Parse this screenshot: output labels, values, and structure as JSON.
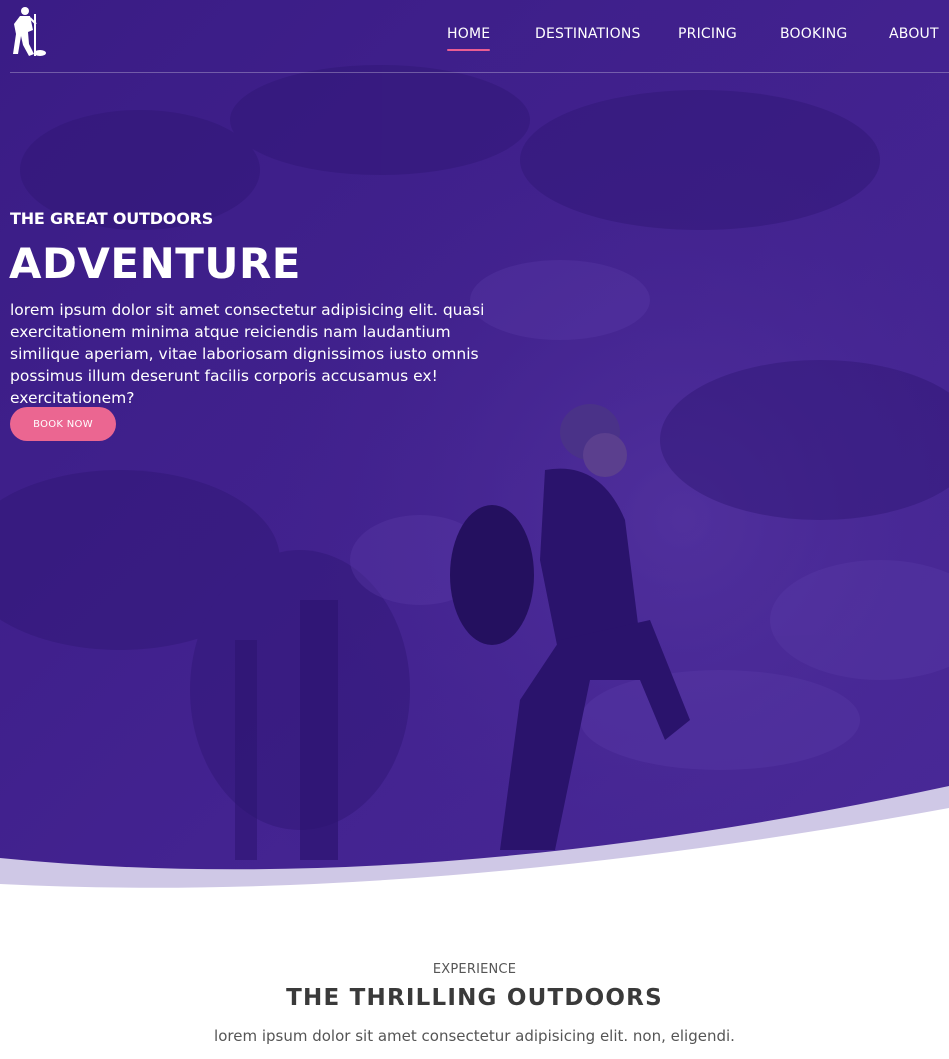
{
  "nav": {
    "logo_icon": "hiker-icon",
    "items": [
      {
        "label": "HOME",
        "active": true
      },
      {
        "label": "DESTINATIONS",
        "active": false
      },
      {
        "label": "PRICING",
        "active": false
      },
      {
        "label": "BOOKING",
        "active": false
      },
      {
        "label": "ABOUT",
        "active": false
      }
    ]
  },
  "hero": {
    "subtitle": "THE GREAT OUTDOORS",
    "title": "ADVENTURE",
    "text": "lorem ipsum dolor sit amet consectetur adipisicing elit. quasi exercitationem minima atque reiciendis nam laudantium similique aperiam, vitae laboriosam dignissimos iusto omnis possimus illum deserunt facilis corporis accusamus ex! exercitationem?",
    "button": "BOOK NOW",
    "overlay_color": "#3d1f8a"
  },
  "section": {
    "eyebrow": "EXPERIENCE",
    "title": "THE THRILLING OUTDOORS",
    "text": "lorem ipsum dolor sit amet consectetur adipisicing elit. non, eligendi."
  },
  "colors": {
    "accent": "#eb6691",
    "hero_purple": "#3d1f8a",
    "text_dark": "#3a3a3a"
  }
}
